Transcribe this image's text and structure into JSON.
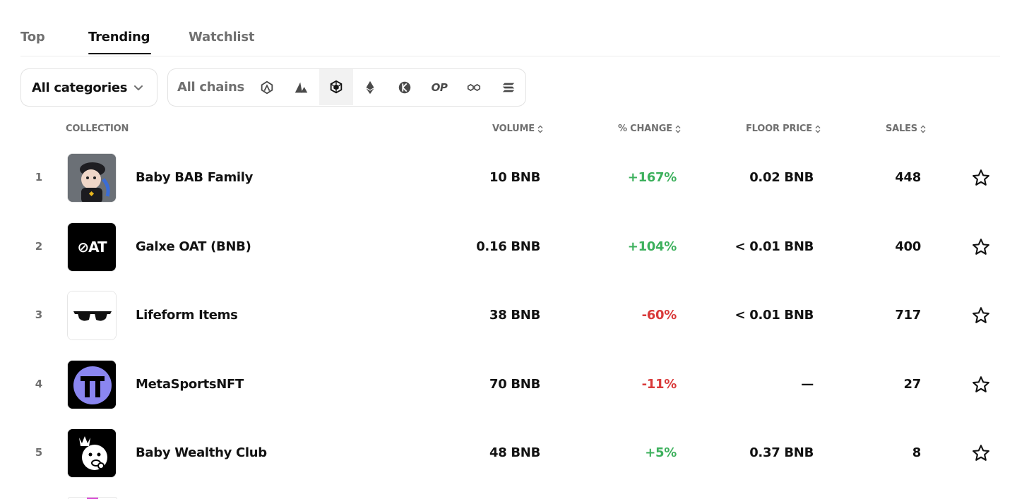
{
  "tabs": [
    {
      "label": "Top"
    },
    {
      "label": "Trending"
    },
    {
      "label": "Watchlist"
    }
  ],
  "filters": {
    "category_label": "All categories",
    "chains_label": "All chains",
    "op_label": "OP",
    "chain_icons": [
      "arbitrum-icon",
      "avalanche-icon",
      "bnb-icon",
      "ethereum-icon",
      "klaytn-icon",
      "optimism-icon",
      "polygon-icon",
      "solana-icon"
    ]
  },
  "table": {
    "headers": {
      "collection": "COLLECTION",
      "volume": "VOLUME",
      "change": "% CHANGE",
      "floor": "FLOOR PRICE",
      "sales": "SALES"
    },
    "rows": [
      {
        "rank": "1",
        "name": "Baby BAB Family",
        "volume": "10 BNB",
        "change": "+167%",
        "floor": "0.02 BNB",
        "sales": "448"
      },
      {
        "rank": "2",
        "name": "Galxe OAT (BNB)",
        "volume": "0.16 BNB",
        "change": "+104%",
        "floor": "< 0.01 BNB",
        "sales": "400",
        "logo_text": "⊘AT"
      },
      {
        "rank": "3",
        "name": "Lifeform Items",
        "volume": "38 BNB",
        "change": "-60%",
        "floor": "< 0.01 BNB",
        "sales": "717"
      },
      {
        "rank": "4",
        "name": "MetaSportsNFT",
        "volume": "70 BNB",
        "change": "-11%",
        "floor": "—",
        "sales": "27"
      },
      {
        "rank": "5",
        "name": "Baby Wealthy Club",
        "volume": "48 BNB",
        "change": "+5%",
        "floor": "0.37 BNB",
        "sales": "8"
      }
    ]
  },
  "colors": {
    "positive": "#3cb05c",
    "negative": "#d93a3a",
    "muted": "#707070",
    "text": "#121212"
  }
}
